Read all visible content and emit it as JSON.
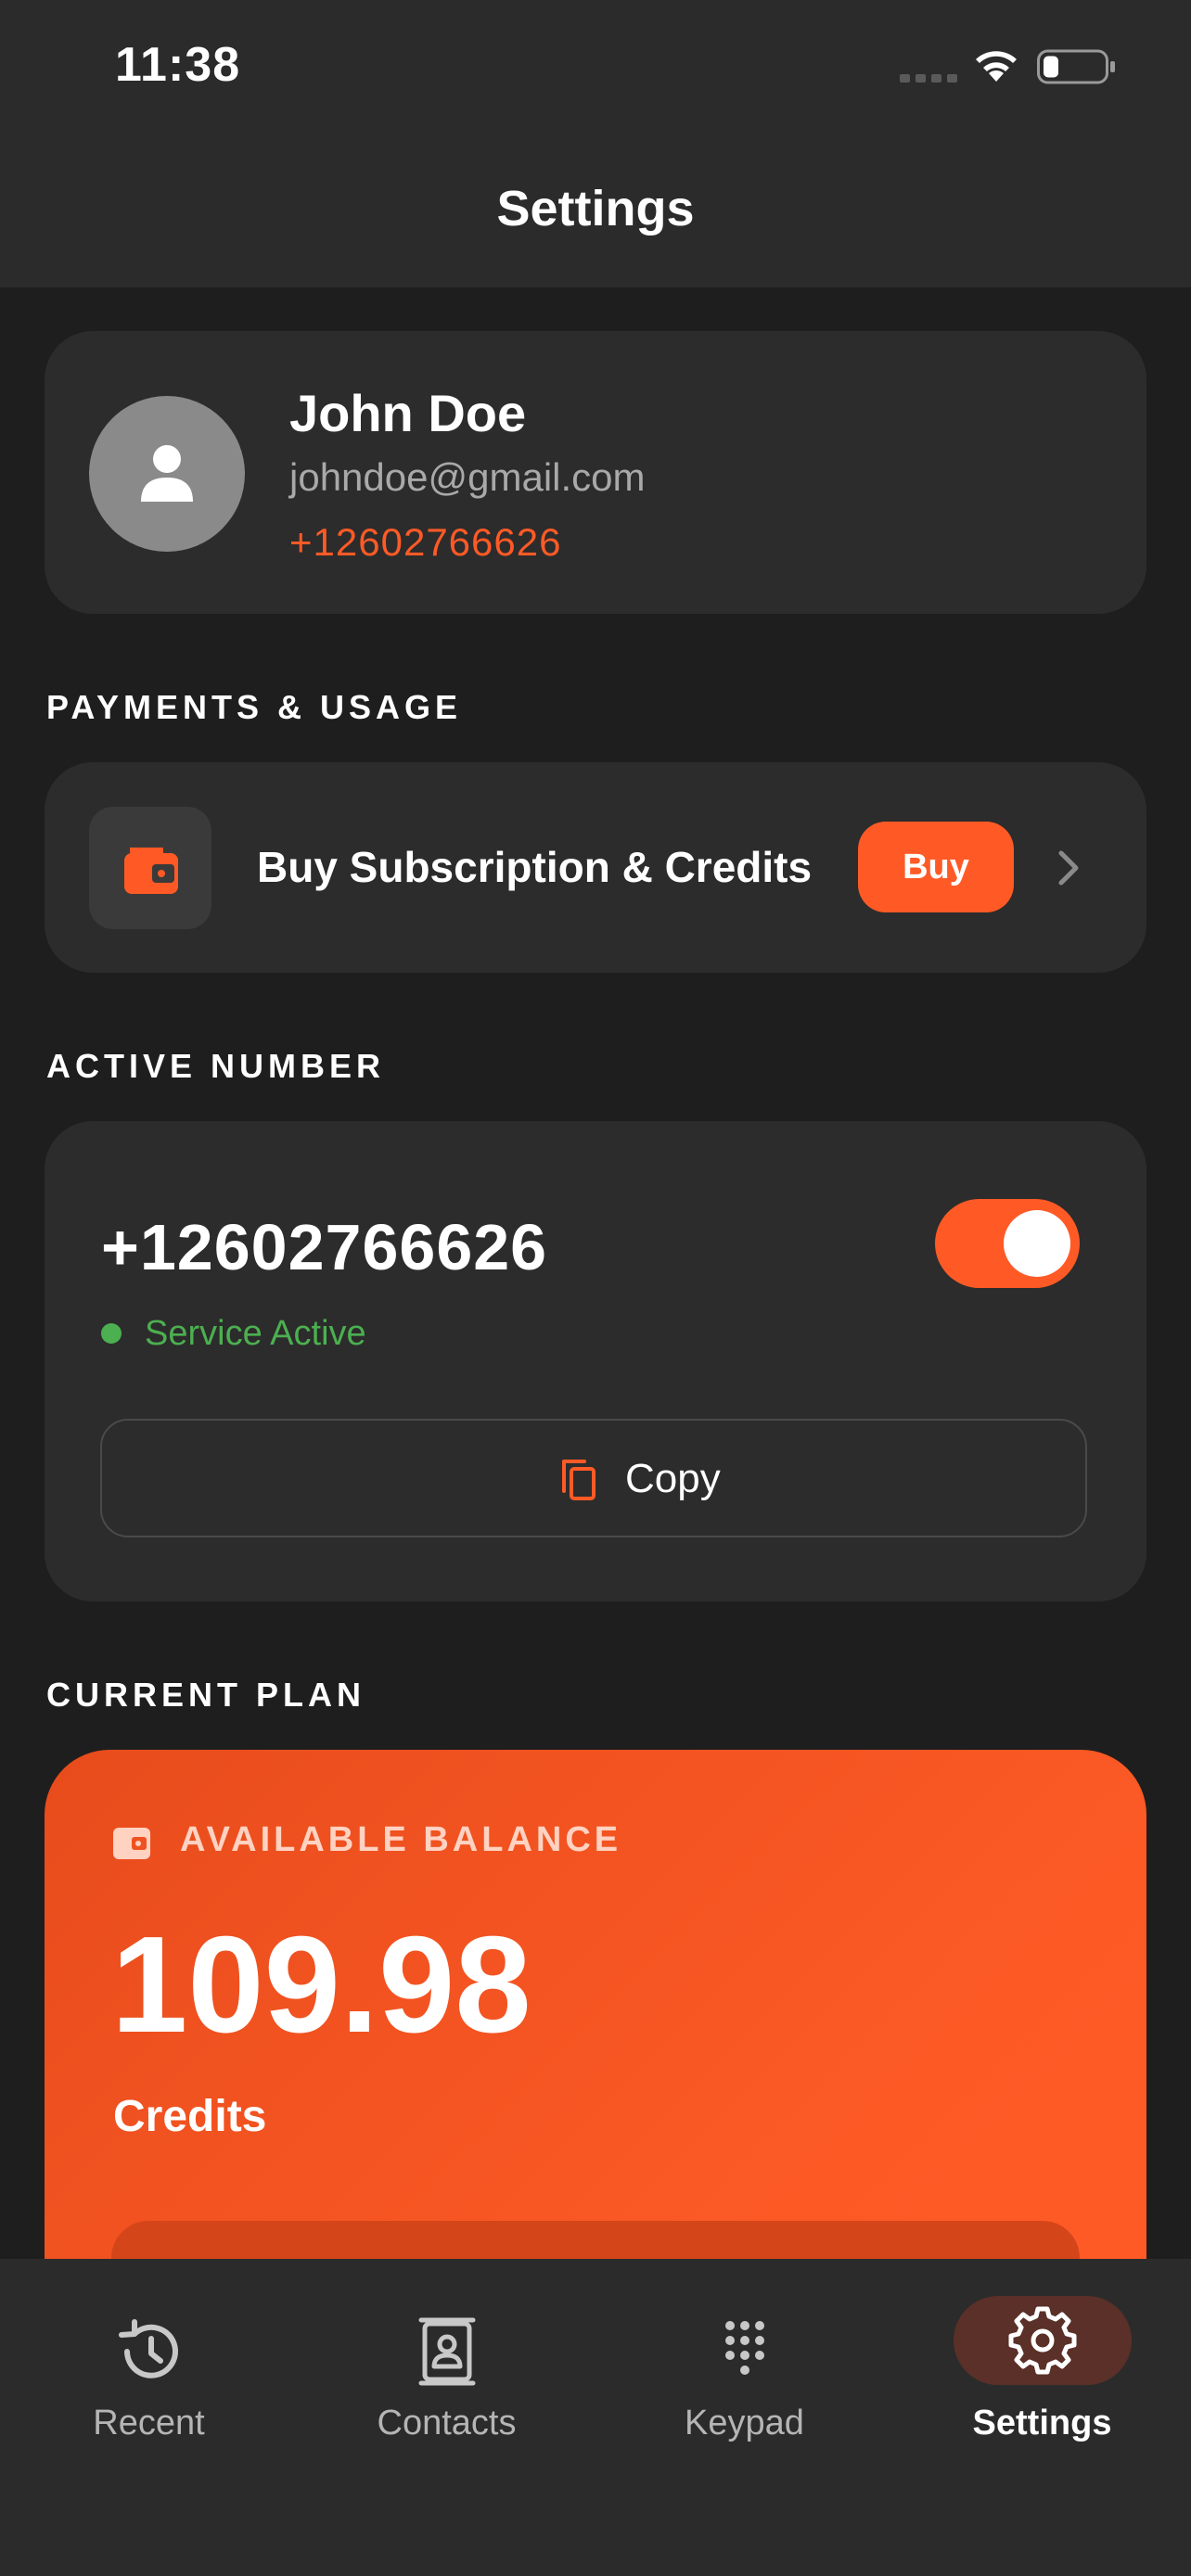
{
  "status_bar": {
    "time": "11:38"
  },
  "header": {
    "title": "Settings"
  },
  "profile": {
    "name": "John Doe",
    "email": "johndoe@gmail.com",
    "phone": "+12602766626"
  },
  "payments": {
    "section_label": "PAYMENTS & USAGE",
    "item_label": "Buy Subscription & Credits",
    "buy_label": "Buy"
  },
  "active_number": {
    "section_label": "ACTIVE NUMBER",
    "number": "+12602766626",
    "status": "Service Active",
    "toggle_on": true,
    "copy_label": "Copy"
  },
  "current_plan": {
    "section_label": "CURRENT PLAN",
    "balance_label": "AVAILABLE BALANCE",
    "balance_value": "109.98",
    "balance_unit": "Credits"
  },
  "tabs": [
    {
      "label": "Recent",
      "icon": "history-icon",
      "active": false
    },
    {
      "label": "Contacts",
      "icon": "contacts-icon",
      "active": false
    },
    {
      "label": "Keypad",
      "icon": "keypad-icon",
      "active": false
    },
    {
      "label": "Settings",
      "icon": "gear-icon",
      "active": true
    }
  ],
  "colors": {
    "accent": "#ff5a26",
    "background": "#1e1e1e",
    "card": "#2c2c2c",
    "success": "#4caf50",
    "muted_text": "#a9a9a9"
  }
}
